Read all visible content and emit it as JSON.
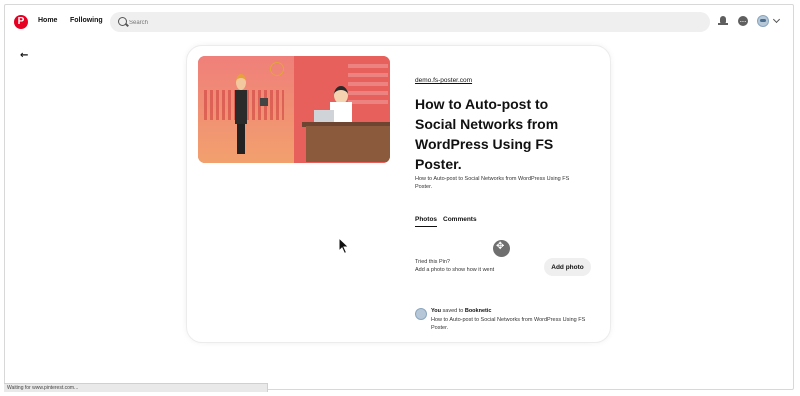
{
  "header": {
    "logo_glyph": "P",
    "nav": {
      "home": "Home",
      "following": "Following"
    },
    "search": {
      "placeholder": "Search"
    },
    "icons": [
      "pinterest-logo-icon",
      "search-icon",
      "bell-icon",
      "chat-icon",
      "avatar-icon",
      "chevron-down-icon"
    ]
  },
  "back_glyph": "←",
  "pin": {
    "domain": "demo.fs-poster.com",
    "title": "How to Auto-post to Social Networks from WordPress Using FS Poster.",
    "description": "How to Auto-post to Social Networks from WordPress Using FS Poster.",
    "tabs": [
      "Photos",
      "Comments"
    ],
    "tried": {
      "title": "Tried this Pin?",
      "subtitle": "Add a photo to show how it went",
      "button": "Add photo"
    },
    "saved": {
      "user": "You",
      "action": "saved to",
      "board": "Booknetic",
      "description": "How to Auto-post to Social Networks from WordPress Using FS Poster."
    }
  },
  "status_bar": "Waiting for www.pinterest.com...",
  "colors": {
    "brand": "#e60023",
    "search_bg": "#efefef",
    "button_bg": "#efefef"
  }
}
